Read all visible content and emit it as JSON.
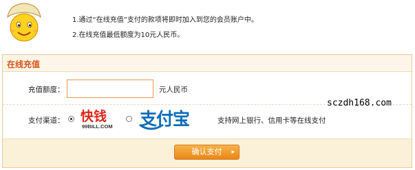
{
  "notice": {
    "items": [
      "1.通过“在线充值”支付的款项将即时加入到您的会员账户中。",
      "2.在线充值最低额度为10元人民币。"
    ]
  },
  "panel": {
    "title": "在线充值"
  },
  "amount": {
    "label": "充值额度：",
    "value": "",
    "unit": "元人民币"
  },
  "payment": {
    "label": "支付渠道：",
    "options": [
      {
        "name": "快钱",
        "sub": "99BILL.COM",
        "selected": true
      },
      {
        "name": "支付宝",
        "selected": false
      }
    ],
    "note": "支持网上银行、信用卡等在线支付"
  },
  "submit": {
    "label": "确认支付",
    "arrow": "▸"
  },
  "watermark": "sczdh168.com",
  "colors": {
    "accent": "#d8541a",
    "button": "#e88817",
    "panel_border": "#f0c898"
  }
}
